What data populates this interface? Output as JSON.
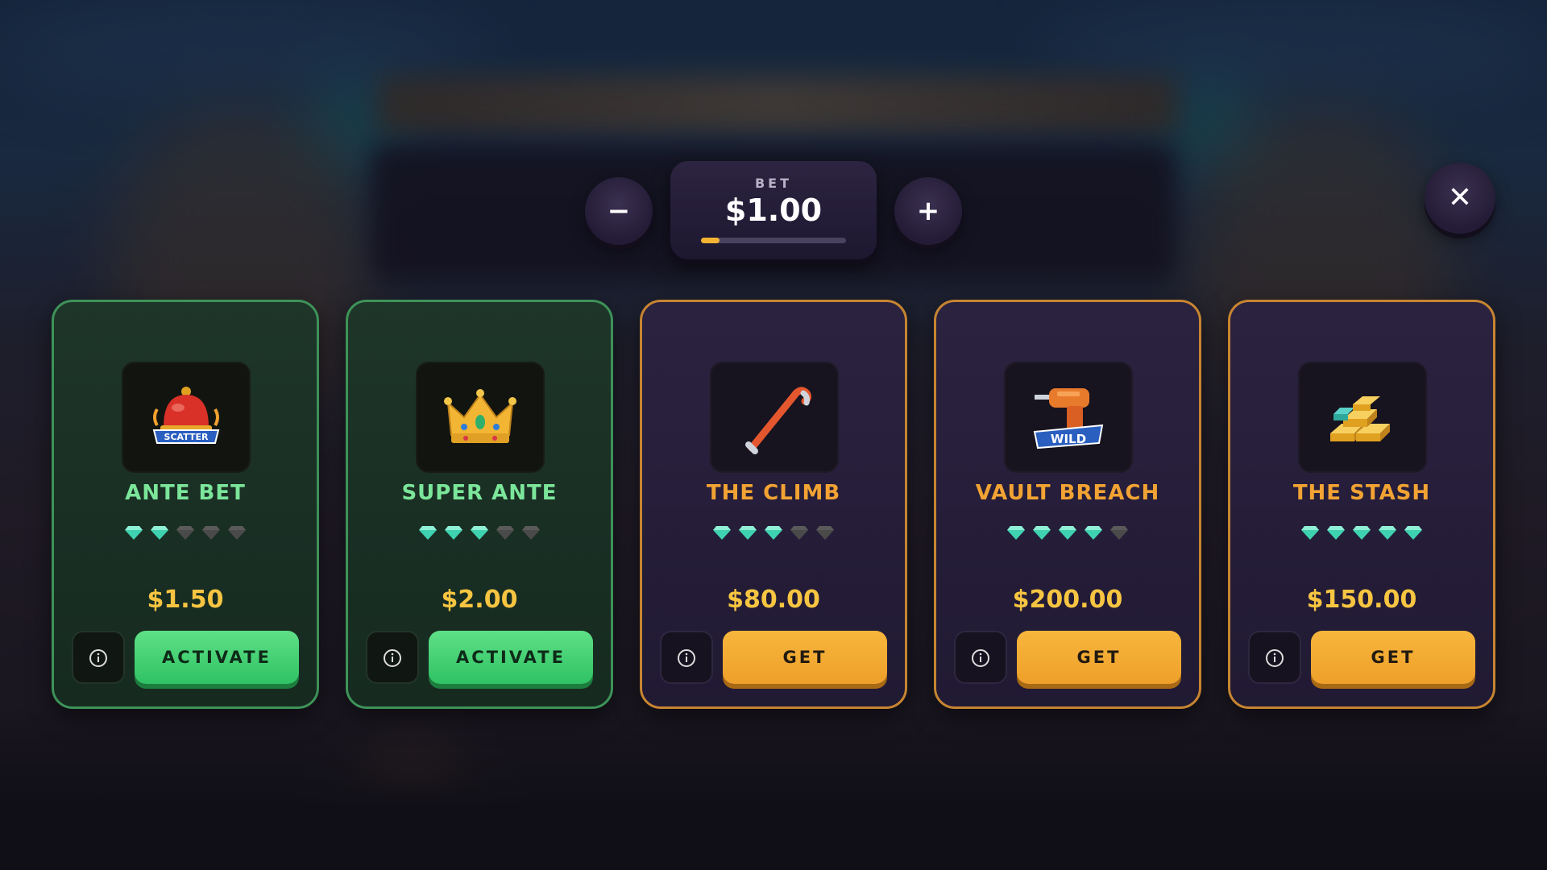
{
  "bet": {
    "label": "BET",
    "value": "$1.00",
    "level": 0.13,
    "minus_symbol": "−",
    "plus_symbol": "+"
  },
  "close_symbol": "✕",
  "colors": {
    "gold": "#f2a333",
    "green": "#7be69a",
    "price": "#f7c541",
    "gem_active": "#3fd2b0",
    "gem_inactive": "#4a4a4a"
  },
  "cards": [
    {
      "title": "ANTE BET",
      "price": "$1.50",
      "action": "ACTIVATE",
      "gems_filled": 2,
      "gems_total": 5,
      "style": "green",
      "icon": "scatter-bell-icon",
      "icon_text": "SCATTER"
    },
    {
      "title": "SUPER ANTE",
      "price": "$2.00",
      "action": "ACTIVATE",
      "gems_filled": 3,
      "gems_total": 5,
      "style": "green",
      "icon": "crown-icon"
    },
    {
      "title": "THE CLIMB",
      "price": "$80.00",
      "action": "GET",
      "gems_filled": 3,
      "gems_total": 5,
      "style": "gold",
      "icon": "crowbar-icon"
    },
    {
      "title": "VAULT BREACH",
      "price": "$200.00",
      "action": "GET",
      "gems_filled": 4,
      "gems_total": 5,
      "style": "gold",
      "icon": "wild-drill-icon",
      "icon_text": "WILD"
    },
    {
      "title": "THE STASH",
      "price": "$150.00",
      "action": "GET",
      "gems_filled": 5,
      "gems_total": 5,
      "style": "gold",
      "icon": "gold-bars-icon"
    }
  ]
}
